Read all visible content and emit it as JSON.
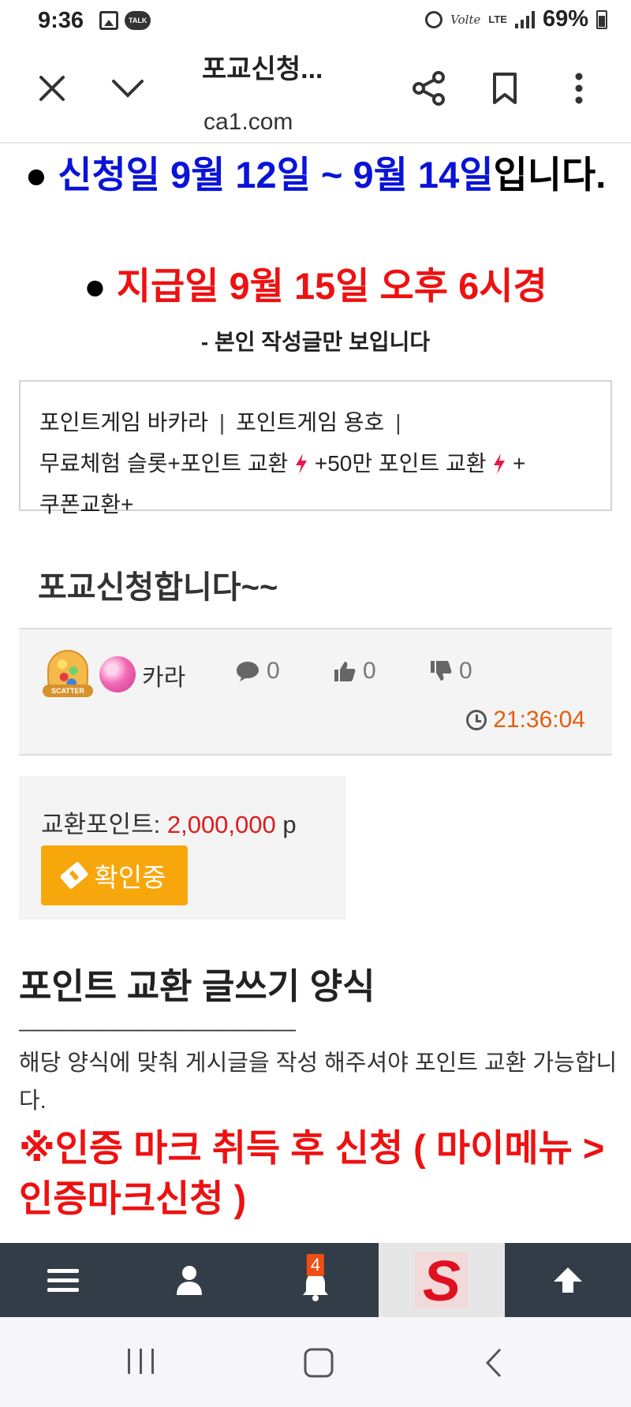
{
  "status_bar": {
    "time": "9:36",
    "left_icons": [
      "image-icon",
      "talk-icon"
    ],
    "talk_label": "TALK",
    "volte_label": "Volte",
    "lte_label": "LTE",
    "battery": "69%",
    "right_icons": [
      "alarm-icon",
      "signal-icon",
      "battery-icon"
    ]
  },
  "browser": {
    "title": "포교신청...",
    "url": "ca1.com",
    "icons": [
      "close-icon",
      "chevron-down-icon",
      "share-icon",
      "bookmark-icon",
      "more-icon"
    ]
  },
  "notices": {
    "apply_bullet": "●",
    "apply_dates": "신청일 9월 12일 ~ 9월 14일",
    "apply_suffix": "입니다.",
    "pay_bullet": "●",
    "pay_text": "지급일 9월 15일 오후 6시경",
    "own_only": "- 본인 작성글만 보입니다"
  },
  "categories": {
    "row1": [
      "포인트게임 바카라",
      "포인트게임 용호"
    ],
    "separator": "|",
    "row2": [
      "무료체험 슬롯+",
      "포인트 교환",
      "+50만 포인트 교환",
      "+"
    ],
    "row3": "쿠폰교환+",
    "bolt_icon": "lightning-icon"
  },
  "post": {
    "title": "포교신청합니다~~",
    "nickname": "카라",
    "level_tag": "SCATTER",
    "comments": "0",
    "likes": "0",
    "dislikes": "0",
    "time": "21:36:04"
  },
  "exchange": {
    "label": "교환포인트:",
    "value": "2,000,000",
    "unit": "p",
    "status": "확인중"
  },
  "form": {
    "title": "포인트 교환 글쓰기 양식",
    "divider": "——————————————",
    "description": "해당 양식에 맞춰 게시글을 작성 해주셔야 포인트 교환 가능합니다.",
    "warning": "※인증 마크 취득 후 신청 ( 마이메뉴 > 인증마크신청 )"
  },
  "site_nav": {
    "notification_count": "4",
    "logo_letter": "S",
    "icons": [
      "menu-icon",
      "user-icon",
      "bell-icon",
      "logo",
      "arrow-up-icon"
    ]
  },
  "colors": {
    "blue": "#0a13d8",
    "red": "#ee1111",
    "orange": "#f7a70c",
    "nav_bg": "#333d48",
    "time_orange": "#e06010"
  }
}
